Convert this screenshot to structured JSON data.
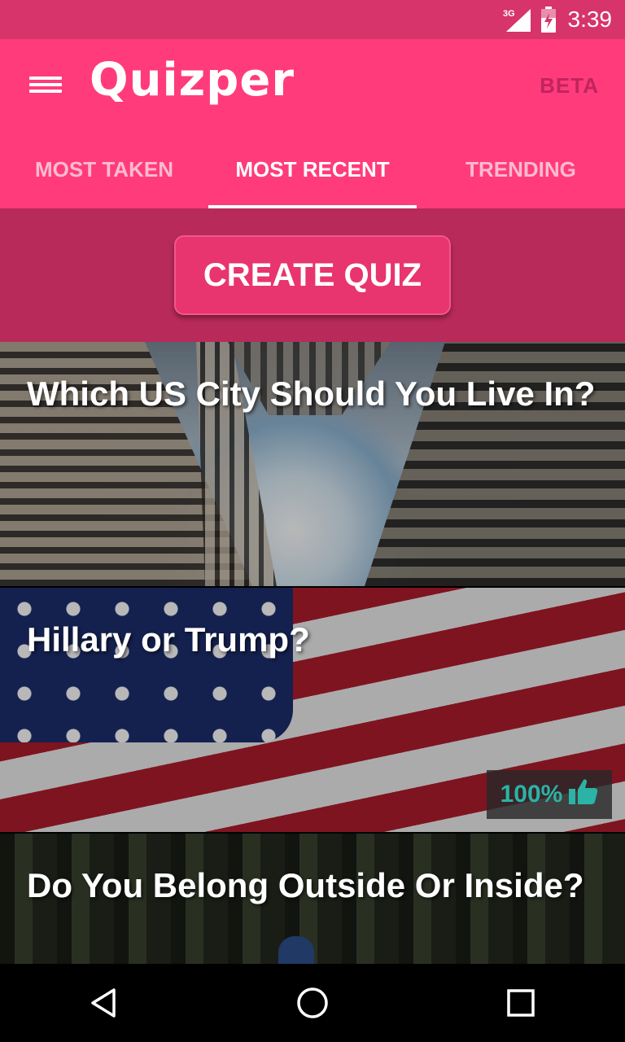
{
  "status_bar": {
    "network": "3G",
    "time": "3:39"
  },
  "app_bar": {
    "title": "Quizper",
    "beta_label": "BETA"
  },
  "tabs": [
    {
      "label": "MOST TAKEN",
      "active": false
    },
    {
      "label": "MOST RECENT",
      "active": true
    },
    {
      "label": "TRENDING",
      "active": false
    }
  ],
  "create_button": {
    "label": "CREATE QUIZ"
  },
  "quizzes": [
    {
      "title": "Which US City Should You Live In?",
      "image": "city-skyscrapers"
    },
    {
      "title": "Hillary or Trump?",
      "image": "american-flag",
      "rating": "100%",
      "rating_icon": "thumbs-up-icon"
    },
    {
      "title": "Do You Belong Outside Or Inside?",
      "image": "forest"
    }
  ],
  "colors": {
    "status_bar": "#d6346a",
    "app_bar": "#ff3b7b",
    "create_area": "#b82a5a",
    "create_button": "#e8346f",
    "rating_text": "#2bb3a6"
  }
}
